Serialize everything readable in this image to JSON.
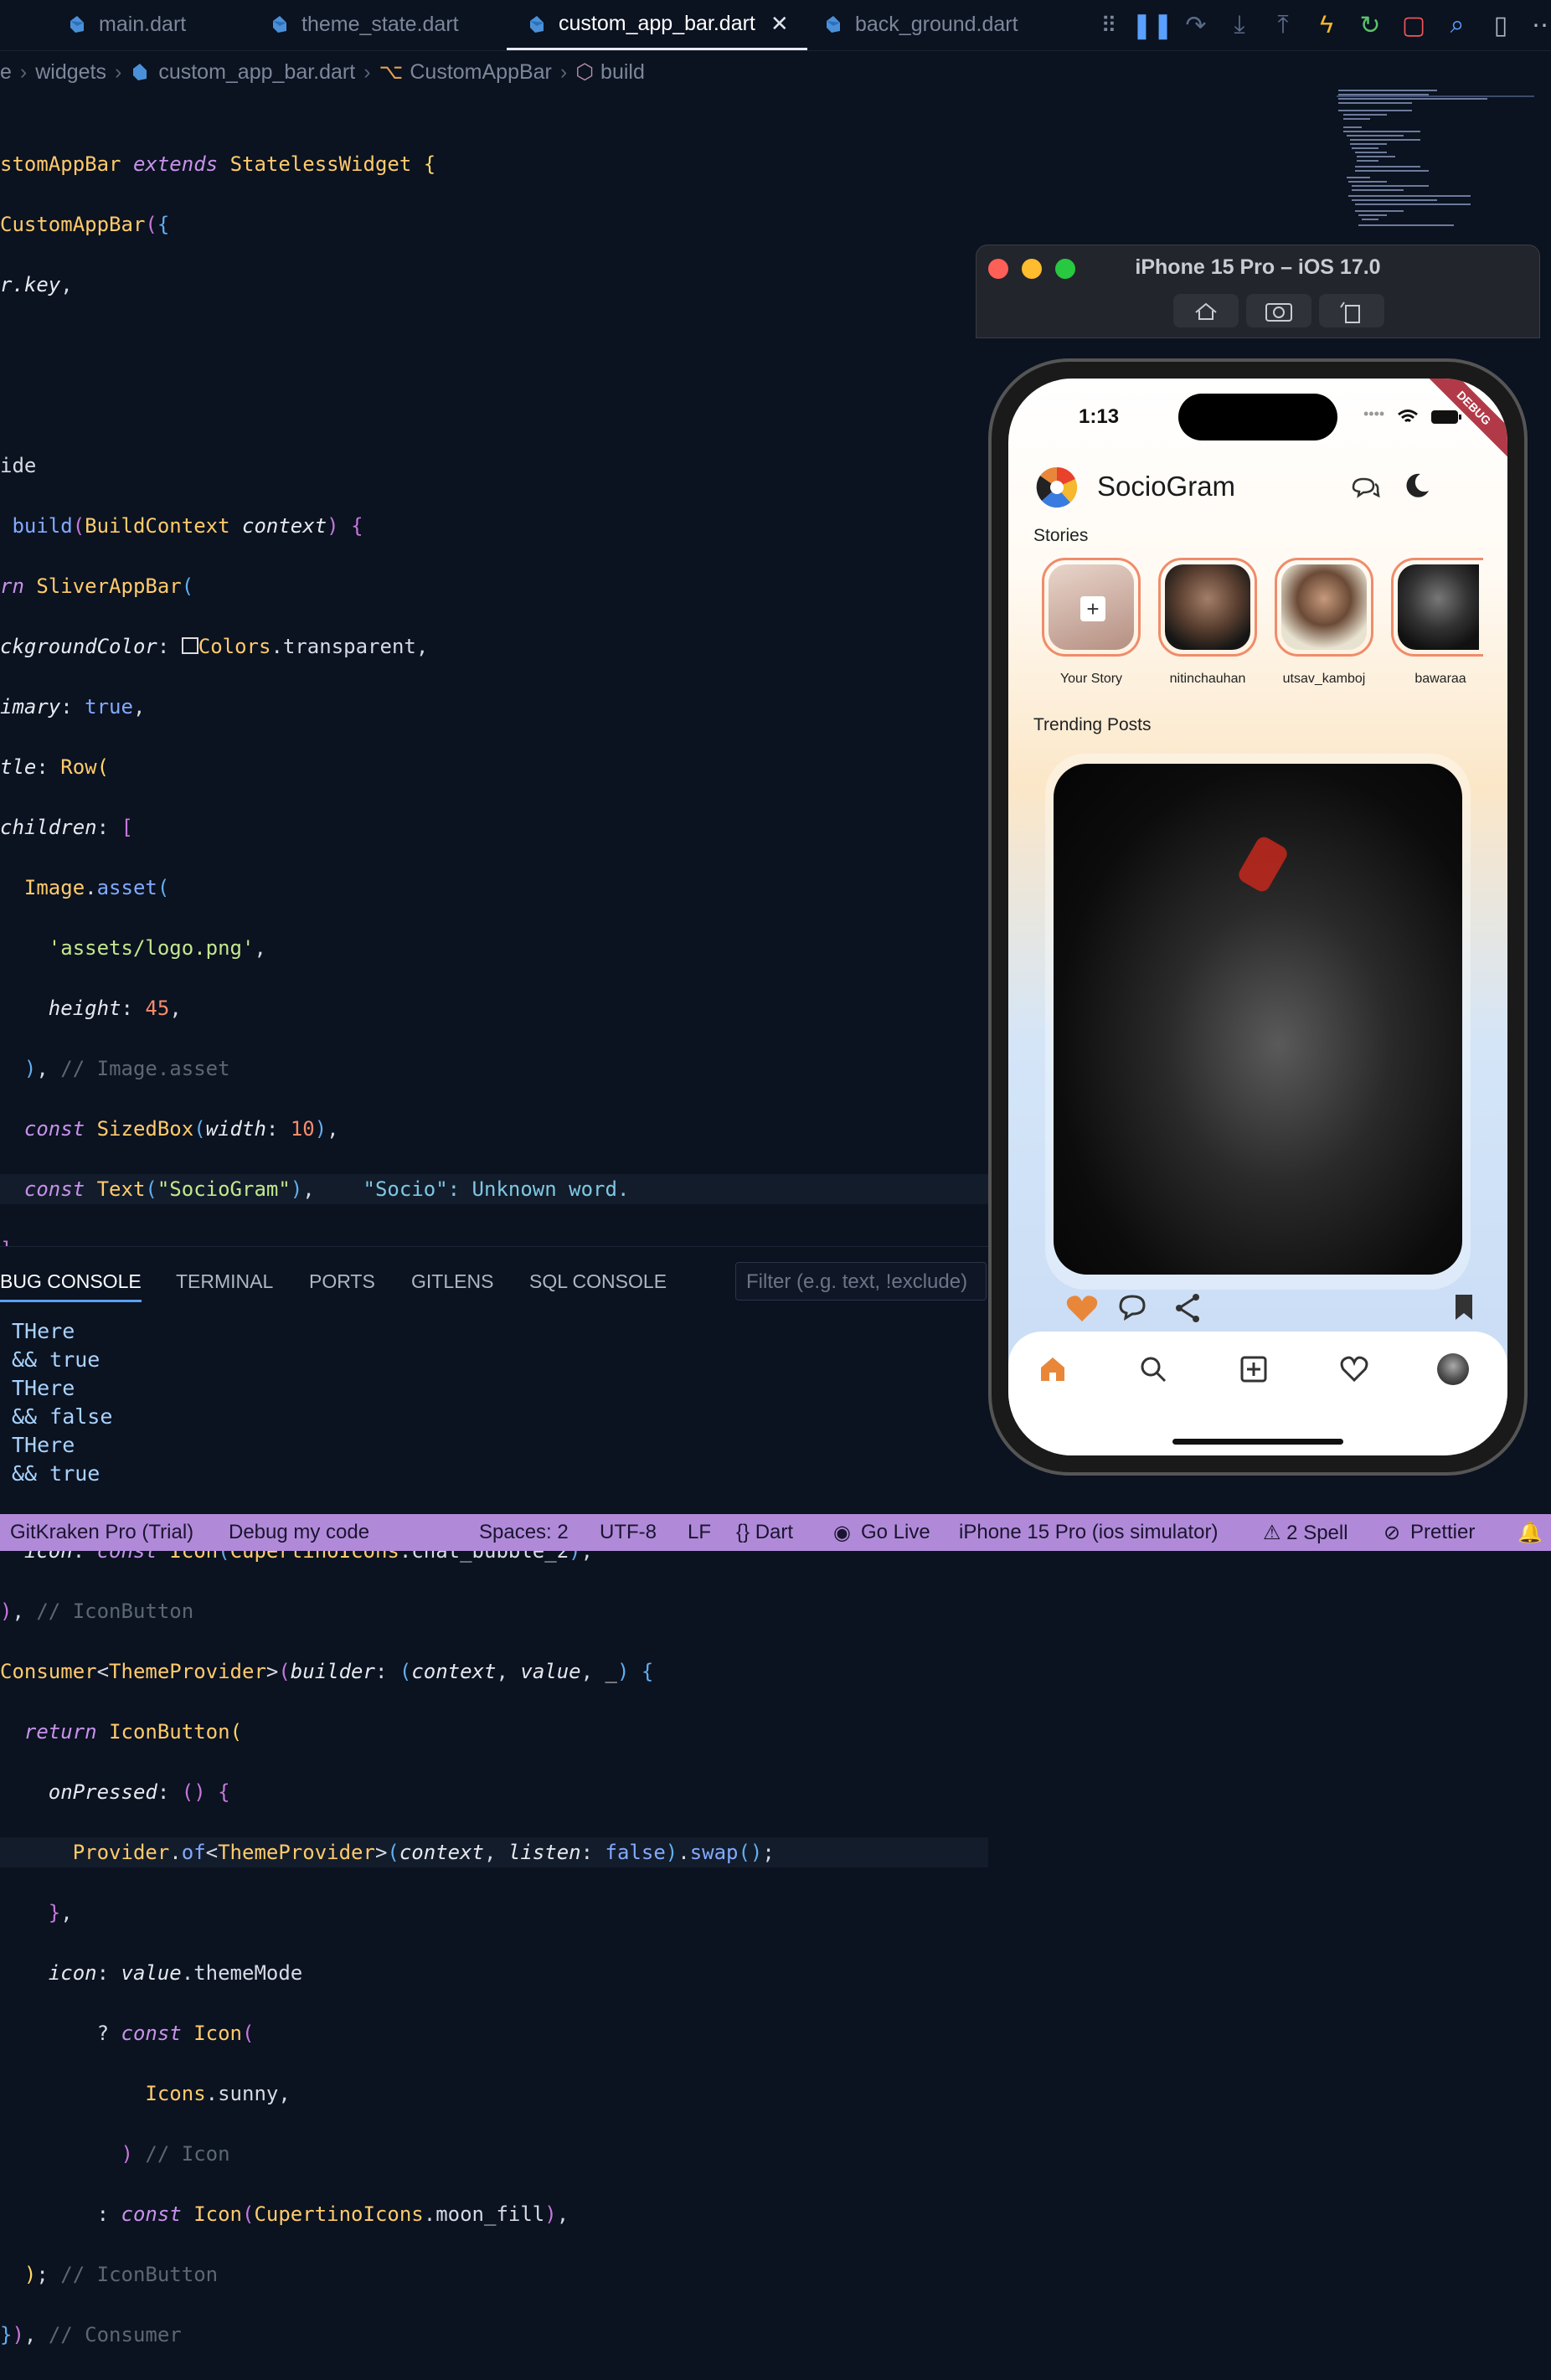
{
  "tabs": [
    {
      "label": "main.dart",
      "active": false
    },
    {
      "label": "theme_state.dart",
      "active": false
    },
    {
      "label": "custom_app_bar.dart",
      "active": true
    },
    {
      "label": "back_ground.dart",
      "active": false
    }
  ],
  "debug_toolbar": [
    "drag-handle",
    "pause",
    "step-over",
    "step-into",
    "step-out",
    "hot-reload",
    "hot-restart",
    "stop",
    "devtools",
    "toggle-panel",
    "more"
  ],
  "breadcrumb": [
    "e",
    "widgets",
    "custom_app_bar.dart",
    "CustomAppBar",
    "build"
  ],
  "code_diagnostic": "\"Socio\": Unknown word.",
  "panel": {
    "tabs": [
      "BUG CONSOLE",
      "TERMINAL",
      "PORTS",
      "GITLENS",
      "SQL CONSOLE"
    ],
    "filter_placeholder": "Filter (e.g. text, !exclude)",
    "console_lines": [
      "THere",
      "&& true",
      "THere",
      "&& false",
      "THere",
      "&& true"
    ]
  },
  "status": {
    "gitkraken": "GitKraken Pro (Trial)",
    "debug": "Debug my code",
    "spaces": "Spaces: 2",
    "encoding": "UTF-8",
    "eol": "LF",
    "language": "{} Dart",
    "golive": "Go Live",
    "device": "iPhone 15 Pro (ios simulator)",
    "spell": "⚠ 2 Spell",
    "prettier": "Prettier"
  },
  "simulator": {
    "title": "iPhone 15 Pro – iOS 17.0"
  },
  "app": {
    "time": "1:13",
    "debug_banner": "DEBUG",
    "name": "SocioGram",
    "stories_heading": "Stories",
    "stories": [
      "Your Story",
      "nitinchauhan",
      "utsav_kamboj",
      "bawaraa"
    ],
    "trending_heading": "Trending Posts"
  },
  "colors": {
    "accent": "#e8873a",
    "statusbar": "#b08ad8",
    "story_ring": "#f08c6a"
  }
}
